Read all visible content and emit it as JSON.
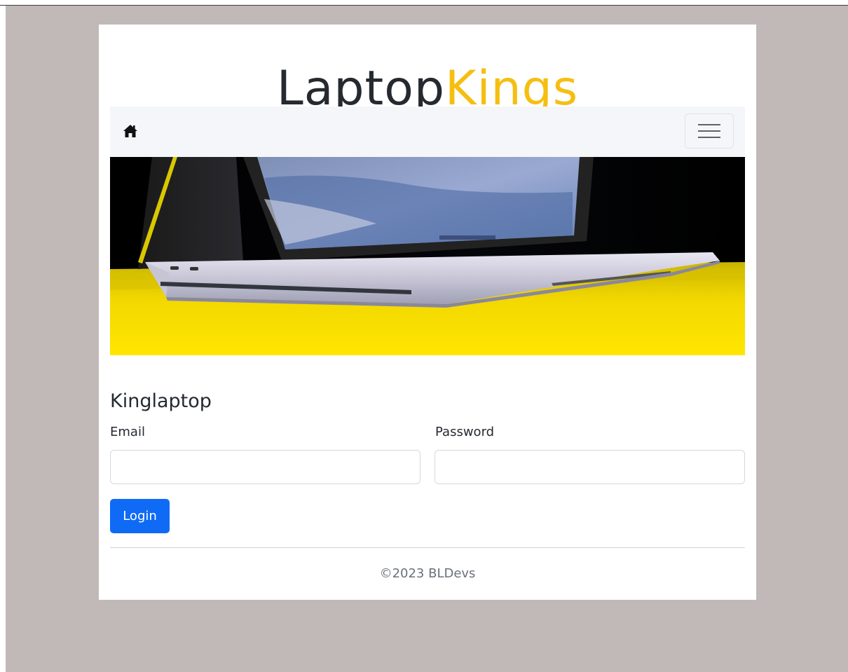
{
  "brand": {
    "part1": "Laptop",
    "part2": "Kings"
  },
  "navbar": {
    "home_icon": "home-icon",
    "menu_icon": "hamburger-icon"
  },
  "hero": {
    "description": "laptop-photo"
  },
  "form": {
    "title": "Kinglaptop",
    "email_label": "Email",
    "email_value": "",
    "password_label": "Password",
    "password_value": "",
    "login_label": "Login"
  },
  "footer": {
    "text": "©2023 BLDevs"
  },
  "colors": {
    "background": "#c1b9b8",
    "brand_dark": "#252a30",
    "brand_accent": "#f5bf12",
    "primary": "#0f6bf5"
  }
}
